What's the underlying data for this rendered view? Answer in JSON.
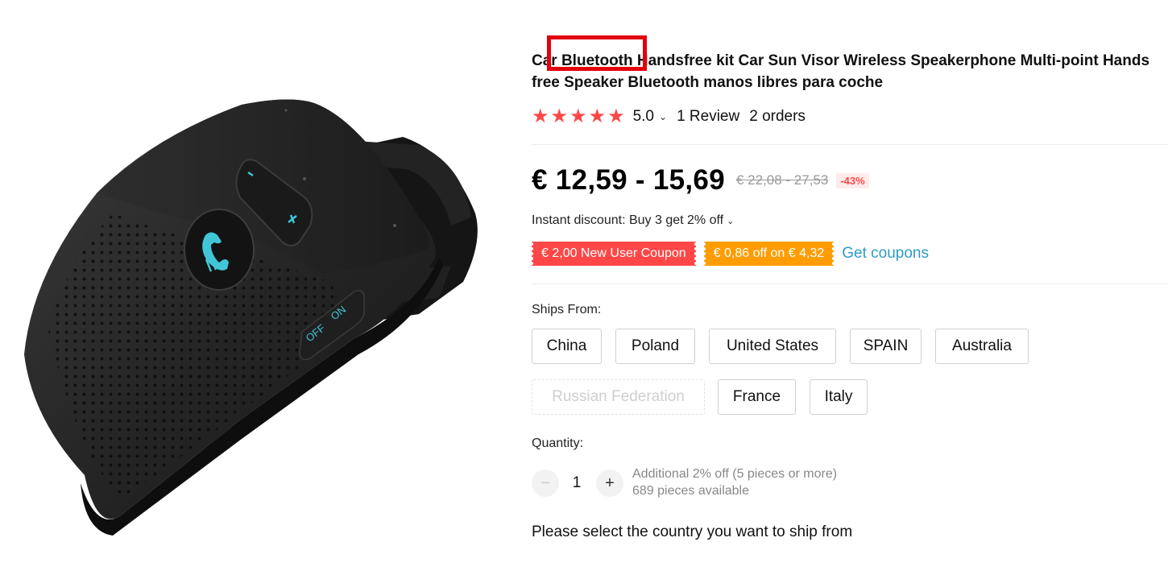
{
  "product": {
    "title": "Car Bluetooth Handsfree kit Car Sun Visor Wireless Speakerphone Multi-point Hands free Speaker Bluetooth manos libres para coche",
    "image_alt": "Bluetooth car speakerphone clipped to sun visor",
    "device_labels": {
      "off": "OFF",
      "on": "ON"
    },
    "highlight_color": "#e3000b"
  },
  "rating": {
    "stars": 5,
    "score": "5.0",
    "reviews": "1 Review",
    "orders": "2 orders",
    "star_color": "#ff4747"
  },
  "price": {
    "current": "€ 12,59 - 15,69",
    "original": "€ 22,08 - 27,53",
    "discount": "-43%"
  },
  "promo": {
    "instant_discount": "Instant discount: Buy 3 get 2% off",
    "coupons": [
      {
        "label": "€ 2,00 New User Coupon",
        "color": "#ff4747"
      },
      {
        "label": "€ 0,86 off on € 4,32",
        "color": "#ff9d00"
      }
    ],
    "get_coupons": "Get coupons",
    "link_color": "#2e9cc3"
  },
  "shipping": {
    "label": "Ships From:",
    "options": [
      {
        "name": "China",
        "enabled": true
      },
      {
        "name": "Poland",
        "enabled": true
      },
      {
        "name": "United States",
        "enabled": true
      },
      {
        "name": "SPAIN",
        "enabled": true
      },
      {
        "name": "Australia",
        "enabled": true
      },
      {
        "name": "Russian Federation",
        "enabled": false
      },
      {
        "name": "France",
        "enabled": true
      },
      {
        "name": "Italy",
        "enabled": true
      }
    ]
  },
  "quantity": {
    "label": "Quantity:",
    "value": "1",
    "minus": "−",
    "plus": "+",
    "additional_discount": "Additional 2% off (5 pieces or more)",
    "available": "689 pieces available"
  },
  "message": "Please select the country you want to ship from"
}
